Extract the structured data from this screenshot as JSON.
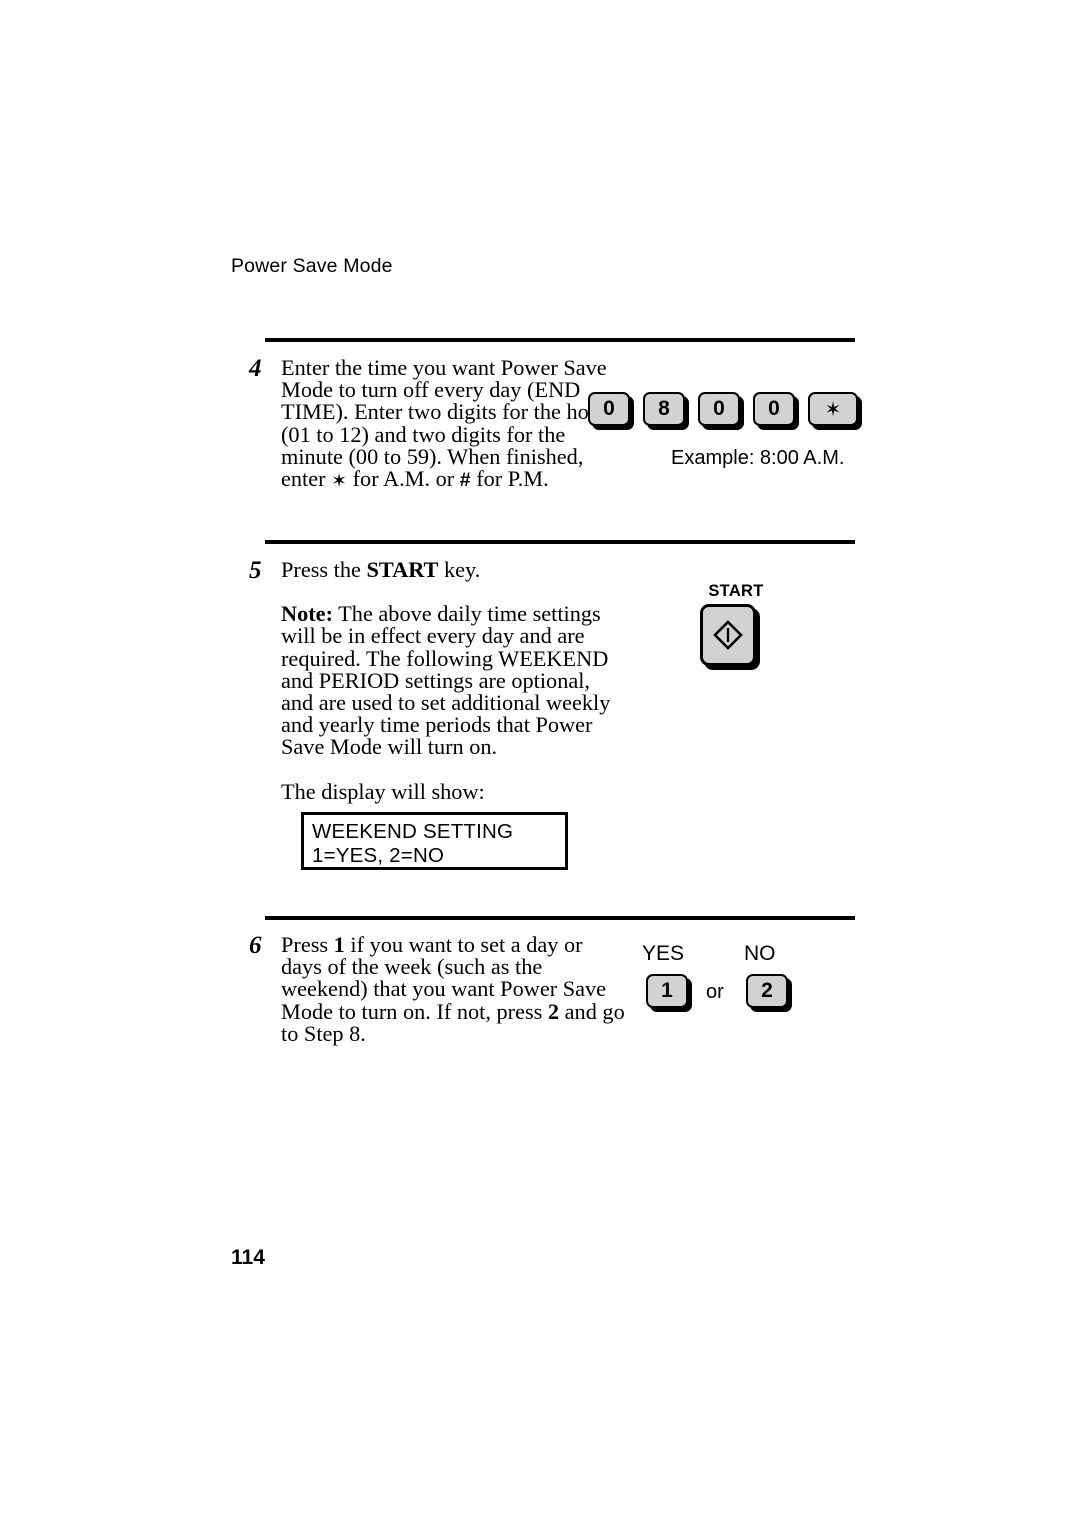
{
  "page": {
    "running_header": "Power Save Mode",
    "page_number": "114"
  },
  "steps": [
    {
      "number": "4",
      "lines": [
        "Enter the time you want Power Save",
        "Mode to turn off every day (END",
        "TIME). Enter two digits for the hour",
        "(01 to 12) and two digits for the",
        "minute (00 to 59). When finished,"
      ],
      "last_line_prefix": "enter ",
      "last_line_star": "✶",
      "last_line_mid": " for A.M. or ",
      "last_line_hash": "#",
      "last_line_suffix": " for P.M.",
      "illustration": {
        "keys": [
          "0",
          "8",
          "0",
          "0"
        ],
        "star_key": "✶",
        "caption": "Example: 8:00 A.M."
      }
    },
    {
      "number": "5",
      "line_1_prefix": "Press the ",
      "line_1_bold": "START",
      "line_1_suffix": " key.",
      "note_bold": "Note:",
      "note_lines": [
        " The above daily time settings",
        "will be in effect every day and are",
        "required. The following WEEKEND",
        "and PERIOD settings are optional,",
        "and are used to set additional weekly",
        "and yearly time periods that Power",
        "Save Mode will turn on."
      ],
      "display_intro": "The display will show:",
      "illustration": {
        "start_label": "START",
        "start_icon": "start-diamond-icon"
      },
      "lcd": {
        "line_1": "WEEKEND SETTING",
        "line_2": "1=YES, 2=NO"
      }
    },
    {
      "number": "6",
      "line_1_prefix": "Press ",
      "line_1_bold": "1",
      "line_1_suffix": " if you want to set a day or",
      "lines": [
        "days of the week (such as the",
        "weekend) that you want Power Save"
      ],
      "line_4_prefix": "Mode to turn on. If not, press ",
      "line_4_bold": "2",
      "line_4_suffix": " and go",
      "line_5": "to Step 8.",
      "illustration": {
        "yes_label": "YES",
        "no_label": "NO",
        "yes_key": "1",
        "no_key": "2",
        "or_text": "or"
      }
    }
  ],
  "colors": {
    "key_fill": "#d2d2d2",
    "ink": "#000000",
    "paper": "#ffffff"
  }
}
